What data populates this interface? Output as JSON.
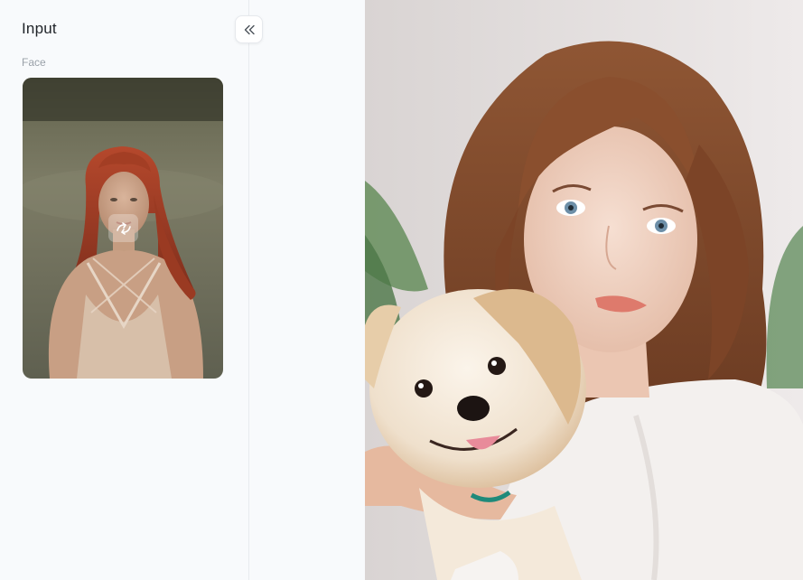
{
  "panel": {
    "title": "Input",
    "face_section_label": "Face"
  },
  "icons": {
    "collapse": "double-chevron-left-icon",
    "swap": "face-swap-icon"
  },
  "colors": {
    "panel_background": "#f8fafc",
    "divider": "#e8ebef",
    "title_text": "#1f2328",
    "label_text": "#9aa1a9"
  }
}
